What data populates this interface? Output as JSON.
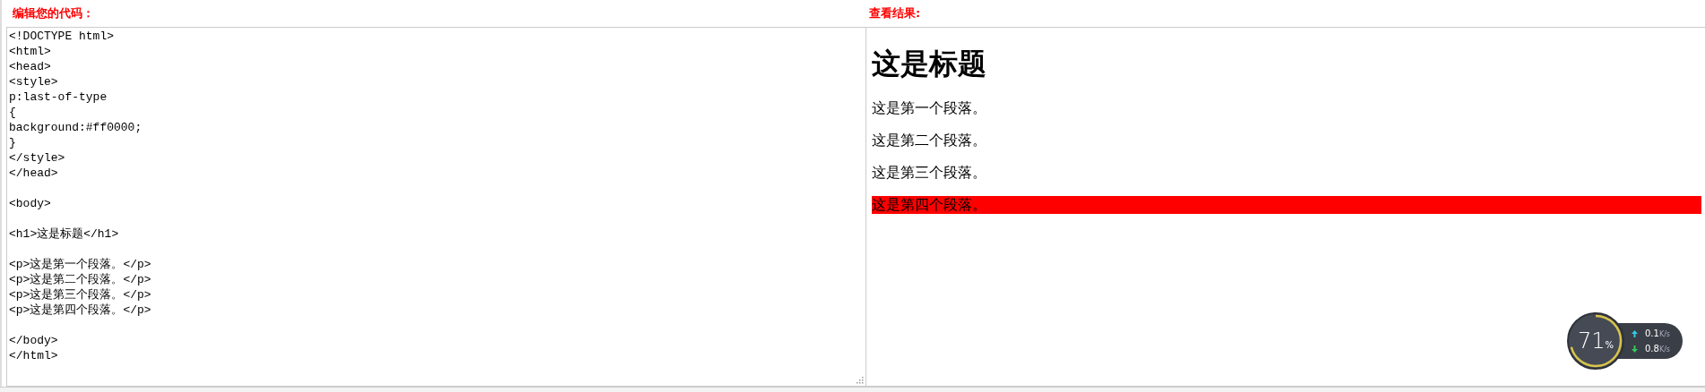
{
  "editor": {
    "title": "编辑您的代码：",
    "code": "<!DOCTYPE html>\n<html>\n<head>\n<style>\np:last-of-type\n{\nbackground:#ff0000;\n}\n</style>\n</head>\n\n<body>\n\n<h1>这是标题</h1>\n\n<p>这是第一个段落。</p>\n<p>这是第二个段落。</p>\n<p>这是第三个段落。</p>\n<p>这是第四个段落。</p>\n\n</body>\n</html>"
  },
  "result": {
    "title": "查看结果:",
    "heading": "这是标题",
    "paragraphs": [
      {
        "text": "这是第一个段落。",
        "highlighted": false
      },
      {
        "text": "这是第二个段落。",
        "highlighted": false
      },
      {
        "text": "这是第三个段落。",
        "highlighted": false
      },
      {
        "text": "这是第四个段落。",
        "highlighted": true
      }
    ]
  },
  "monitor": {
    "percent": "71",
    "unit": "%",
    "rates": [
      {
        "kind": "upload",
        "value": "0.1",
        "unit": "K/s"
      },
      {
        "kind": "download",
        "value": "0.8",
        "unit": "K/s"
      }
    ]
  }
}
